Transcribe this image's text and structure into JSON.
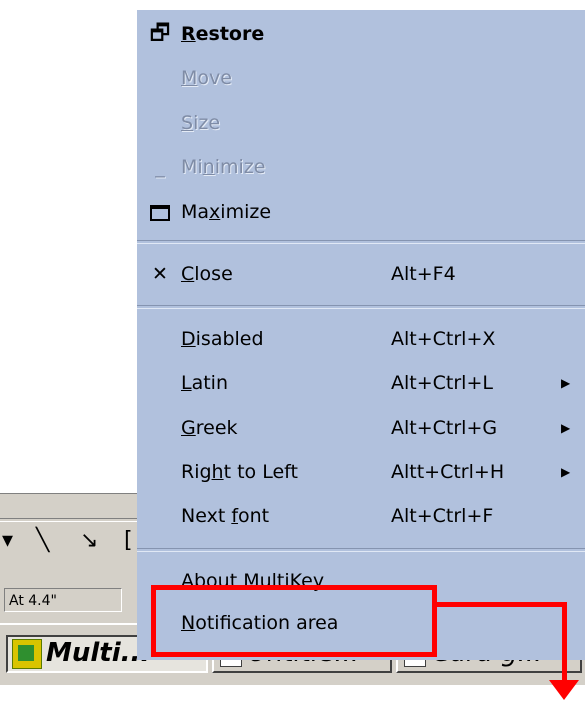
{
  "menu": {
    "items": [
      {
        "pre": "",
        "ul": "R",
        "post": "estore",
        "accel": "",
        "icon": "restore-icon",
        "state": "bold"
      },
      {
        "pre": "",
        "ul": "M",
        "post": "ove",
        "accel": "",
        "icon": "",
        "state": "disabled"
      },
      {
        "pre": "",
        "ul": "S",
        "post": "ize",
        "accel": "",
        "icon": "",
        "state": "disabled"
      },
      {
        "pre": "Mi",
        "ul": "n",
        "post": "imize",
        "accel": "",
        "icon": "minimize-icon",
        "state": "disabled"
      },
      {
        "pre": "Ma",
        "ul": "x",
        "post": "imize",
        "accel": "",
        "icon": "maximize-icon",
        "state": "normal"
      },
      {
        "pre": "",
        "ul": "C",
        "post": "lose",
        "accel": "Alt+F4",
        "icon": "close-icon",
        "state": "normal"
      },
      {
        "pre": "",
        "ul": "D",
        "post": "isabled",
        "accel": "Alt+Ctrl+X",
        "icon": "",
        "state": "normal"
      },
      {
        "pre": "",
        "ul": "L",
        "post": "atin",
        "accel": "Alt+Ctrl+L",
        "icon": "",
        "state": "submenu"
      },
      {
        "pre": "",
        "ul": "G",
        "post": "reek",
        "accel": "Alt+Ctrl+G",
        "icon": "",
        "state": "submenu"
      },
      {
        "pre": "Rig",
        "ul": "h",
        "post": "t to Left",
        "accel": "Altt+Ctrl+H",
        "icon": "",
        "state": "submenu"
      },
      {
        "pre": "Next ",
        "ul": "f",
        "post": "ont",
        "accel": "Alt+Ctrl+F",
        "icon": "",
        "state": "normal"
      },
      {
        "pre": "",
        "ul": "A",
        "post": "bout MultiKey",
        "accel": "",
        "icon": "",
        "state": "normal"
      },
      {
        "pre": "",
        "ul": "N",
        "post": "otification area",
        "accel": "",
        "icon": "",
        "state": "normal"
      }
    ],
    "submenu_glyph": "▶",
    "restore_glyph": "🗗",
    "minimize_glyph": "_",
    "close_glyph": "✕"
  },
  "background": {
    "status_text": "At 4.4\"",
    "taskbar": [
      {
        "label": "Multi...",
        "active": true
      },
      {
        "label": "Untitle...",
        "active": false
      },
      {
        "label": "Cara g...",
        "active": false
      }
    ]
  },
  "colors": {
    "menu_bg": "#b1c1dd",
    "disabled_text": "#7f8ca6",
    "annotation": "#ff0000",
    "window_bg": "#d4d0c8"
  }
}
